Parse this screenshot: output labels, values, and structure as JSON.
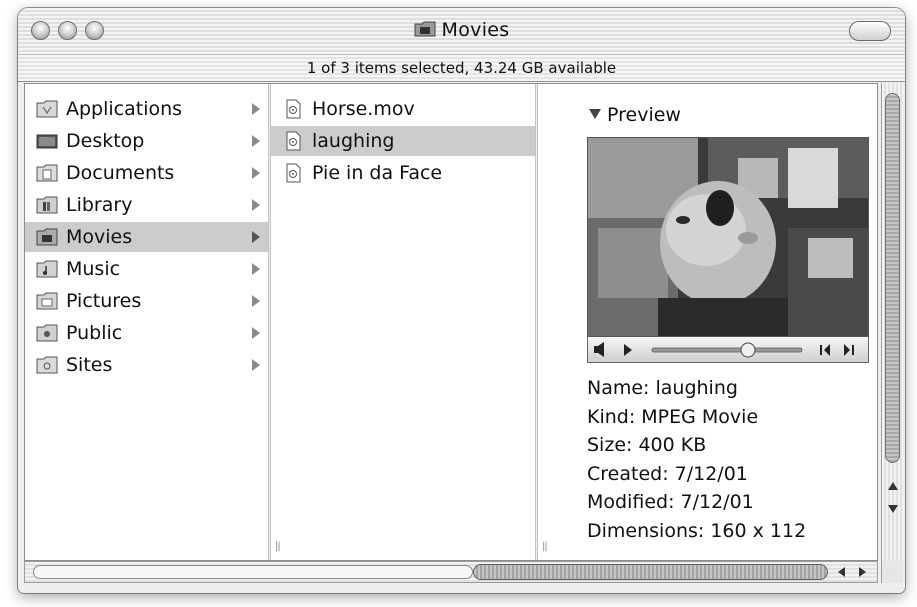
{
  "window": {
    "title": "Movies",
    "status": "1 of 3 items selected, 43.24 GB available"
  },
  "sidebar": {
    "items": [
      {
        "label": "Applications",
        "icon": "applications-folder-icon"
      },
      {
        "label": "Desktop",
        "icon": "desktop-icon"
      },
      {
        "label": "Documents",
        "icon": "documents-folder-icon"
      },
      {
        "label": "Library",
        "icon": "library-folder-icon"
      },
      {
        "label": "Movies",
        "icon": "movies-folder-icon",
        "selected": true
      },
      {
        "label": "Music",
        "icon": "music-folder-icon"
      },
      {
        "label": "Pictures",
        "icon": "pictures-folder-icon"
      },
      {
        "label": "Public",
        "icon": "public-folder-icon"
      },
      {
        "label": "Sites",
        "icon": "sites-folder-icon"
      }
    ]
  },
  "files": {
    "items": [
      {
        "label": "Horse.mov",
        "icon": "movie-file-icon"
      },
      {
        "label": "laughing",
        "icon": "movie-file-icon",
        "selected": true
      },
      {
        "label": "Pie in da Face",
        "icon": "movie-file-icon"
      }
    ]
  },
  "preview": {
    "header": "Preview",
    "info": [
      "Name:  laughing",
      "Kind:  MPEG Movie",
      "Size:  400 KB",
      "Created:  7/12/01",
      "Modified:  7/12/01",
      "Dimensions:  160 x 112"
    ]
  },
  "colors": {
    "selection": "#cccccc",
    "window_bg": "#efefef"
  }
}
